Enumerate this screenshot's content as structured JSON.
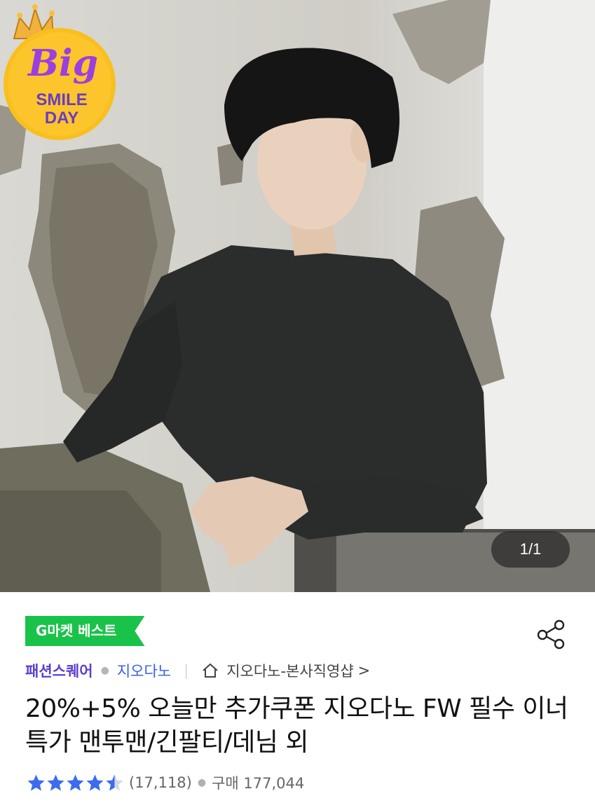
{
  "hero": {
    "image_label": "product-photo",
    "counter": "1/1"
  },
  "promo": {
    "line1": "Big",
    "line2": "SMILE",
    "line3": "DAY"
  },
  "badge": {
    "best": "G마켓 베스트"
  },
  "breadcrumb": {
    "category": "패션스퀘어",
    "brand": "지오다노",
    "shop": "지오다노-본사직영샵",
    "arrow": ">"
  },
  "product": {
    "title": "20%+5% 오늘만 추가쿠폰 지오다노 FW 필수 이너 특가 맨투맨/긴팔티/데님 외",
    "rating": 4.5,
    "review_count": "(17,118)",
    "purchase": "구매 177,044"
  },
  "colors": {
    "accent_green": "#19c249",
    "category_purple": "#5a3fd0",
    "brand_blue": "#3460e8",
    "star_blue": "#3b6cf0"
  }
}
